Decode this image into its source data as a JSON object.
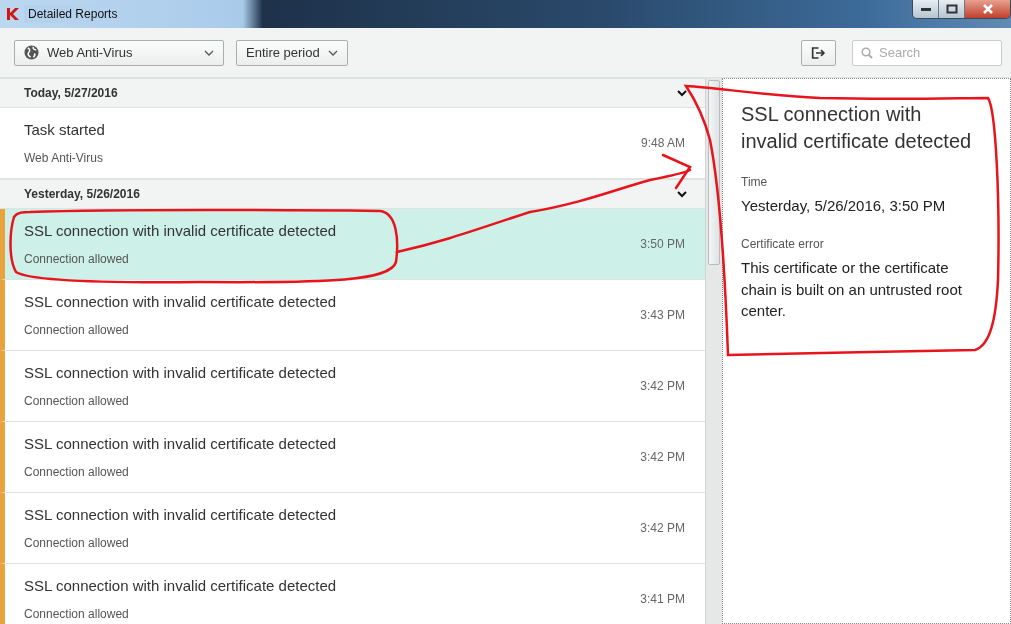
{
  "window": {
    "title": "Detailed Reports"
  },
  "toolbar": {
    "component_filter": "Web Anti-Virus",
    "period_filter": "Entire period",
    "search": {
      "placeholder": "Search"
    }
  },
  "groups": [
    {
      "label": "Today, 5/27/2016",
      "expanded": true,
      "events": [
        {
          "title": "Task started",
          "subtitle": "Web Anti-Virus",
          "time": "9:48 AM",
          "kind": "info",
          "selected": false
        }
      ]
    },
    {
      "label": "Yesterday, 5/26/2016",
      "expanded": true,
      "events": [
        {
          "title": "SSL connection with invalid certificate detected",
          "subtitle": "Connection allowed",
          "time": "3:50 PM",
          "kind": "warning",
          "selected": true
        },
        {
          "title": "SSL connection with invalid certificate detected",
          "subtitle": "Connection allowed",
          "time": "3:43 PM",
          "kind": "warning",
          "selected": false
        },
        {
          "title": "SSL connection with invalid certificate detected",
          "subtitle": "Connection allowed",
          "time": "3:42 PM",
          "kind": "warning",
          "selected": false
        },
        {
          "title": "SSL connection with invalid certificate detected",
          "subtitle": "Connection allowed",
          "time": "3:42 PM",
          "kind": "warning",
          "selected": false
        },
        {
          "title": "SSL connection with invalid certificate detected",
          "subtitle": "Connection allowed",
          "time": "3:42 PM",
          "kind": "warning",
          "selected": false
        },
        {
          "title": "SSL connection with invalid certificate detected",
          "subtitle": "Connection allowed",
          "time": "3:41 PM",
          "kind": "warning",
          "selected": false
        }
      ]
    }
  ],
  "details": {
    "title": "SSL connection with invalid certificate detected",
    "fields": [
      {
        "label": "Time",
        "value": "Yesterday, 5/26/2016, 3:50 PM"
      },
      {
        "label": "Certificate error",
        "value": "This certificate or the certificate chain is built on an untrusted root center."
      }
    ]
  }
}
